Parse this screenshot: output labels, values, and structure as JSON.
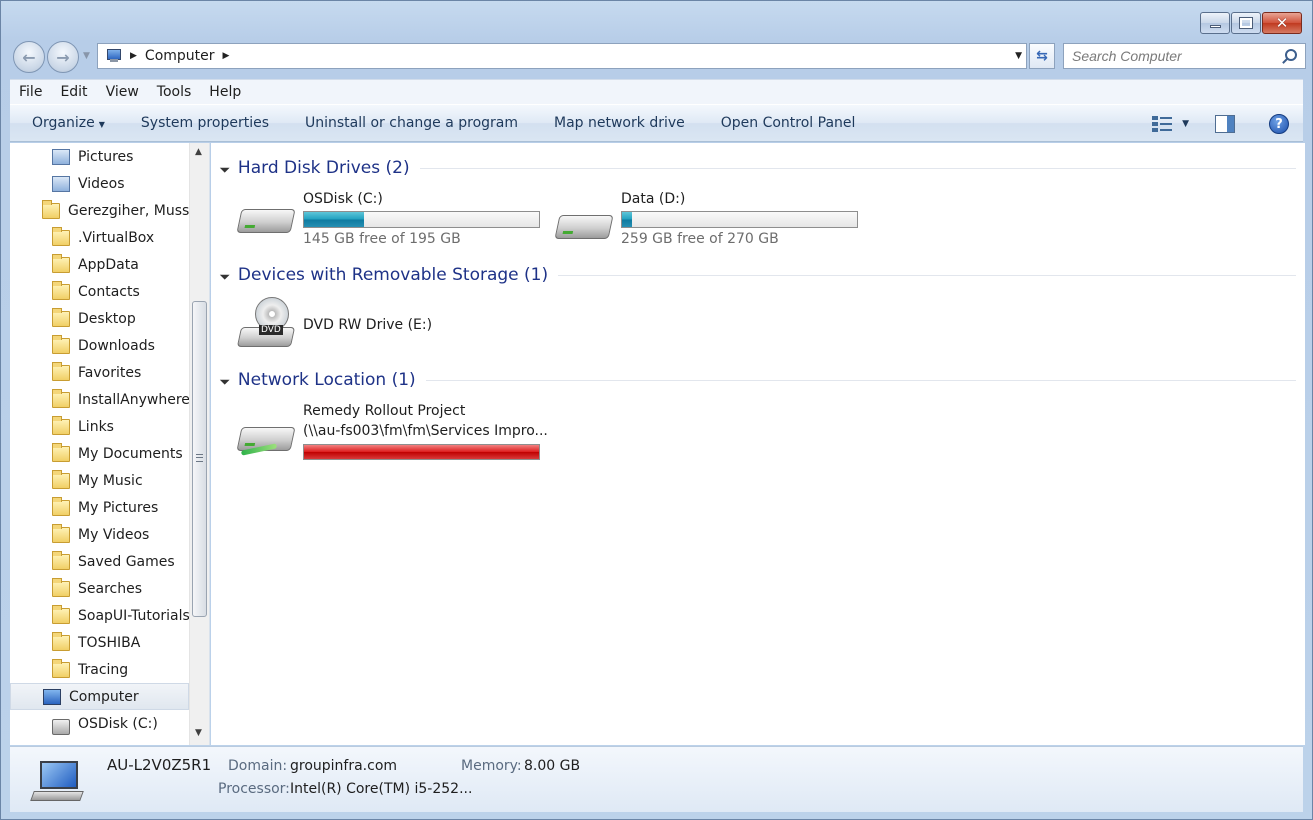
{
  "address": {
    "location": "Computer"
  },
  "search": {
    "placeholder": "Search Computer"
  },
  "menu": [
    "File",
    "Edit",
    "View",
    "Tools",
    "Help"
  ],
  "toolbar": {
    "organize": "Organize",
    "system_properties": "System properties",
    "uninstall": "Uninstall or change a program",
    "map_drive": "Map network drive",
    "control_panel": "Open Control Panel"
  },
  "nav_tree": [
    {
      "label": "Pictures",
      "icon": "library-pictures-icon"
    },
    {
      "label": "Videos",
      "icon": "library-videos-icon"
    },
    {
      "label": "Gerezgiher, Mussie",
      "icon": "user-folder-icon"
    },
    {
      "label": ".VirtualBox",
      "icon": "folder-icon"
    },
    {
      "label": "AppData",
      "icon": "folder-icon"
    },
    {
      "label": "Contacts",
      "icon": "folder-icon"
    },
    {
      "label": "Desktop",
      "icon": "folder-icon"
    },
    {
      "label": "Downloads",
      "icon": "folder-icon"
    },
    {
      "label": "Favorites",
      "icon": "folder-icon"
    },
    {
      "label": "InstallAnywhere",
      "icon": "folder-icon"
    },
    {
      "label": "Links",
      "icon": "folder-icon"
    },
    {
      "label": "My Documents",
      "icon": "folder-icon"
    },
    {
      "label": "My Music",
      "icon": "folder-icon"
    },
    {
      "label": "My Pictures",
      "icon": "folder-icon"
    },
    {
      "label": "My Videos",
      "icon": "folder-icon"
    },
    {
      "label": "Saved Games",
      "icon": "folder-icon"
    },
    {
      "label": "Searches",
      "icon": "folder-icon"
    },
    {
      "label": "SoapUI-Tutorials",
      "icon": "folder-icon"
    },
    {
      "label": "TOSHIBA",
      "icon": "folder-icon"
    },
    {
      "label": "Tracing",
      "icon": "folder-icon"
    },
    {
      "label": "Computer",
      "icon": "computer-icon",
      "selected": true
    },
    {
      "label": "OSDisk (C:)",
      "icon": "drive-icon"
    }
  ],
  "groups": {
    "hdd": "Hard Disk Drives (2)",
    "removable": "Devices with Removable Storage (1)",
    "network": "Network Location (1)"
  },
  "drives": {
    "c": {
      "name": "OSDisk (C:)",
      "free": "145 GB free of 195 GB",
      "used_fraction": 0.256
    },
    "d": {
      "name": "Data (D:)",
      "free": "259 GB free of 270 GB",
      "used_fraction": 0.041
    },
    "dvd": {
      "name": "DVD RW Drive (E:)",
      "label": "DVD"
    },
    "net": {
      "name": "Remedy Rollout Project",
      "path": "(\\\\au-fs003\\fm\\fm\\Services Impro...",
      "used_fraction": 1.0
    }
  },
  "details": {
    "computer_name": "AU-L2V0Z5R1",
    "domain_label": "Domain:",
    "domain": "groupinfra.com",
    "memory_label": "Memory:",
    "memory": "8.00 GB",
    "processor_label": "Processor:",
    "processor": "Intel(R) Core(TM) i5-252..."
  },
  "colors": {
    "group_title": "#1e3287",
    "bar_teal": "#1fa0bf",
    "bar_red": "#c00000"
  }
}
